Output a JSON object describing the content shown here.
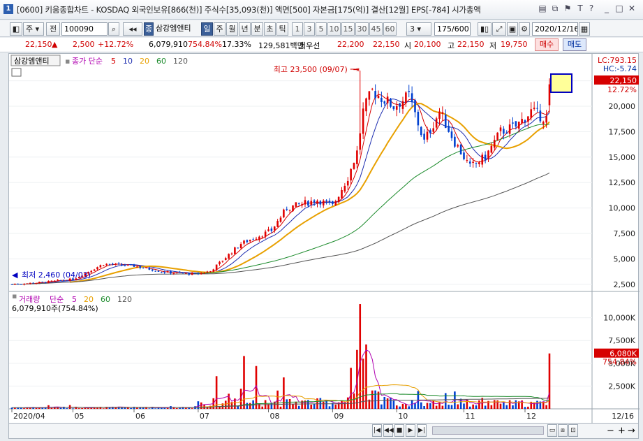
{
  "window": {
    "number": "1",
    "title": "[0600] 키움종합차트 - KOSDAQ 외국인보유[866(천)] 주식수[35,093(천)] 액면[500] 자본금[175(억)] 결산[12월] EPS[-784] 시가총액"
  },
  "toolbar": {
    "market": "주",
    "prev": "전",
    "code": "100090",
    "type_badge": "종",
    "name": "삼강엠앤티",
    "periods": [
      "일",
      "주",
      "월",
      "년",
      "분",
      "초",
      "틱"
    ],
    "selected_period": "일",
    "minutes": [
      "1",
      "3",
      "5",
      "10",
      "15",
      "30",
      "45",
      "60"
    ],
    "n_select": "3",
    "count": "175/600",
    "date": "2020/12/16"
  },
  "quote": {
    "price": "22,150",
    "arrow": "▲",
    "change": "2,500",
    "pct": "+12.72%",
    "volume": "6,079,910",
    "vol_ratio": "754.84%",
    "turnover": "17.33%",
    "amount": "129,581백만",
    "best_ask_label": "최우선",
    "best_ask": "22,200",
    "best_bid": "22,150",
    "open_label": "시",
    "open": "20,100",
    "high_label": "고",
    "high": "22,150",
    "low_label": "저",
    "low": "19,750",
    "buy": "매수",
    "sell": "매도"
  },
  "price_panel": {
    "stock_name": "삼강엠앤티",
    "legend_label": "종가 단순",
    "ma": [
      "5",
      "10",
      "20",
      "60",
      "120"
    ],
    "ma_colors": [
      "#d60000",
      "#1f2fb0",
      "#e8a000",
      "#1a8a2a",
      "#555555"
    ],
    "max_label": "최고 23,500 (09/07)",
    "min_label": "최저 2,460 (04/03)",
    "lc": "LC:793.15",
    "hc": "HC:-5.74",
    "cur_price": "22,150",
    "cur_pct": "12.72%",
    "axis": [
      {
        "v": 22500,
        "t": "22,500"
      },
      {
        "v": 20000,
        "t": "20,000"
      },
      {
        "v": 17500,
        "t": "17,500"
      },
      {
        "v": 15000,
        "t": "15,000"
      },
      {
        "v": 12500,
        "t": "12,500"
      },
      {
        "v": 10000,
        "t": "10,000"
      },
      {
        "v": 7500,
        "t": "7,500"
      },
      {
        "v": 5000,
        "t": "5,000"
      },
      {
        "v": 2500,
        "t": "2,500"
      }
    ]
  },
  "volume_panel": {
    "label": "거래량",
    "legend_label": "단순",
    "ma": [
      "5",
      "20",
      "60",
      "120"
    ],
    "ma_colors": [
      "#b000b0",
      "#e8a000",
      "#1a8a2a",
      "#555555"
    ],
    "cur_text": "6,079,910주(754.84%)",
    "cur_vol": "6,080K",
    "cur_pct": "754.84%",
    "axis": [
      {
        "v": 10000,
        "t": "10,000K"
      },
      {
        "v": 7500,
        "t": "7,500K"
      },
      {
        "v": 5000,
        "t": "5,000K"
      },
      {
        "v": 2500,
        "t": "2,500K"
      }
    ]
  },
  "x_axis": {
    "labels": [
      "2020/04",
      "05",
      "06",
      "07",
      "08",
      "09",
      "10",
      "11",
      "12"
    ],
    "end_label": "12/16"
  },
  "chart_data": {
    "type": "candlestick",
    "series_anchor": [
      [
        0,
        2500
      ],
      [
        10,
        2700
      ],
      [
        20,
        3000
      ],
      [
        30,
        4500
      ],
      [
        40,
        4300
      ],
      [
        50,
        3700
      ],
      [
        60,
        3500
      ],
      [
        65,
        3800
      ],
      [
        75,
        6500
      ],
      [
        85,
        7800
      ],
      [
        90,
        10000
      ],
      [
        100,
        10800
      ],
      [
        105,
        10200
      ],
      [
        110,
        13000
      ],
      [
        113,
        15500
      ],
      [
        115,
        19500
      ],
      [
        118,
        21500
      ],
      [
        125,
        20000
      ],
      [
        130,
        21000
      ],
      [
        135,
        16500
      ],
      [
        140,
        19500
      ],
      [
        145,
        16500
      ],
      [
        150,
        14000
      ],
      [
        155,
        15000
      ],
      [
        160,
        17500
      ],
      [
        165,
        18000
      ],
      [
        170,
        19500
      ],
      [
        175,
        18800
      ],
      [
        176,
        22150
      ]
    ],
    "max": 23500,
    "min": 2460,
    "last": {
      "open": 20100,
      "high": 22150,
      "low": 19750,
      "close": 22150,
      "volume": 6079910
    }
  }
}
